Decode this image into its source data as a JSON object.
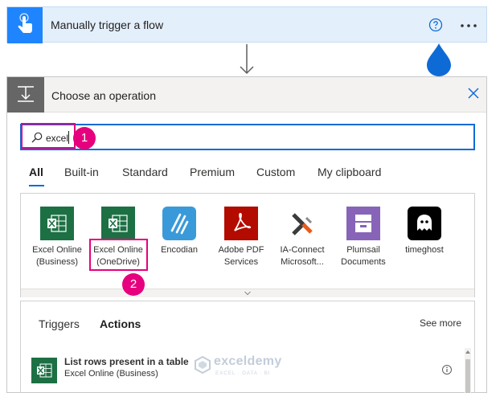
{
  "trigger": {
    "title": "Manually trigger a flow",
    "icon": "touch-hand-icon",
    "help_icon": "help-circle-icon",
    "more_icon": "ellipsis-icon",
    "accent": "#1f85ff"
  },
  "panel": {
    "title": "Choose an operation",
    "close_icon": "close-icon"
  },
  "search": {
    "value": "excel",
    "icon": "search-icon"
  },
  "annotations": {
    "badge1": "1",
    "badge2": "2",
    "highlight_color": "#e6007e"
  },
  "category_tabs": [
    {
      "label": "All",
      "active": true
    },
    {
      "label": "Built-in",
      "active": false
    },
    {
      "label": "Standard",
      "active": false
    },
    {
      "label": "Premium",
      "active": false
    },
    {
      "label": "Custom",
      "active": false
    },
    {
      "label": "My clipboard",
      "active": false
    }
  ],
  "connectors": [
    {
      "line1": "Excel Online",
      "line2": "(Business)",
      "icon": "excel-icon",
      "color": "#1d7044"
    },
    {
      "line1": "Excel Online",
      "line2": "(OneDrive)",
      "icon": "excel-icon",
      "color": "#1d7044"
    },
    {
      "line1": "Encodian",
      "line2": "",
      "icon": "encodian-icon",
      "color": "#3a9ad9"
    },
    {
      "line1": "Adobe PDF",
      "line2": "Services",
      "icon": "adobe-pdf-icon",
      "color": "#b30b00"
    },
    {
      "line1": "IA-Connect",
      "line2": "Microsoft...",
      "icon": "ia-connect-icon",
      "color": "#ffffff"
    },
    {
      "line1": "Plumsail",
      "line2": "Documents",
      "icon": "plumsail-icon",
      "color": "#8764b8"
    },
    {
      "line1": "timeghost",
      "line2": "",
      "icon": "timeghost-icon",
      "color": "#000000"
    }
  ],
  "results": {
    "tabs": [
      {
        "label": "Triggers",
        "active": false
      },
      {
        "label": "Actions",
        "active": true
      }
    ],
    "see_more": "See more",
    "rows": [
      {
        "title": "List rows present in a table",
        "subtitle": "Excel Online (Business)",
        "icon": "excel-icon"
      }
    ]
  },
  "watermark": {
    "name": "exceldemy",
    "tagline": "EXCEL · DATA · BI"
  }
}
